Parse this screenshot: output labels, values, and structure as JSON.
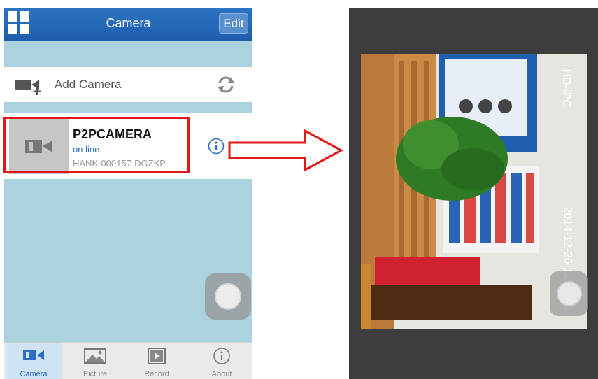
{
  "left_screen": {
    "navbar": {
      "title": "Camera",
      "edit_label": "Edit"
    },
    "add_camera": {
      "label": "Add Camera"
    },
    "camera_item": {
      "name": "P2PCAMERA",
      "status": "on line",
      "uid": "HANK-000157-DGZKP"
    },
    "tabs": [
      {
        "label": "Camera",
        "icon": "camera-icon",
        "active": true
      },
      {
        "label": "Picture",
        "icon": "picture-icon",
        "active": false
      },
      {
        "label": "Record",
        "icon": "record-icon",
        "active": false
      },
      {
        "label": "About",
        "icon": "info-icon",
        "active": false
      }
    ]
  },
  "right_screen": {
    "overlay_name": "HD-IPC",
    "overlay_timestamp": "2014-12-26 12:19:35"
  },
  "colors": {
    "navbar": "#1d5eab",
    "background": "#abd3df",
    "accent": "#2e6fc3",
    "highlight": "#e01818"
  }
}
